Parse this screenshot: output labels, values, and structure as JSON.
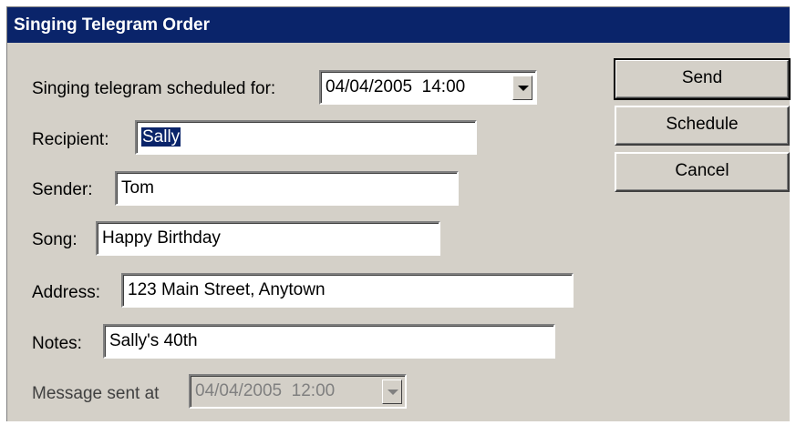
{
  "window": {
    "title": "Singing Telegram Order"
  },
  "form": {
    "scheduled_label": "Singing telegram scheduled for:",
    "scheduled_value": "04/04/2005  14:00",
    "recipient_label": "Recipient:",
    "recipient_value": "Sally",
    "sender_label": "Sender:",
    "sender_value": "Tom",
    "song_label": "Song:",
    "song_value": "Happy Birthday",
    "address_label": "Address:",
    "address_value": "123 Main Street, Anytown",
    "notes_label": "Notes:",
    "notes_value": "Sally's 40th",
    "sent_label": "Message sent at",
    "sent_value": "04/04/2005  12:00"
  },
  "buttons": {
    "send": "Send",
    "schedule": "Schedule",
    "cancel": "Cancel"
  },
  "colors": {
    "titlebar": "#0a246a",
    "face": "#d4d0c8",
    "selection": "#0a246a"
  },
  "icons": {
    "dropdown": "chevron-down-icon"
  }
}
